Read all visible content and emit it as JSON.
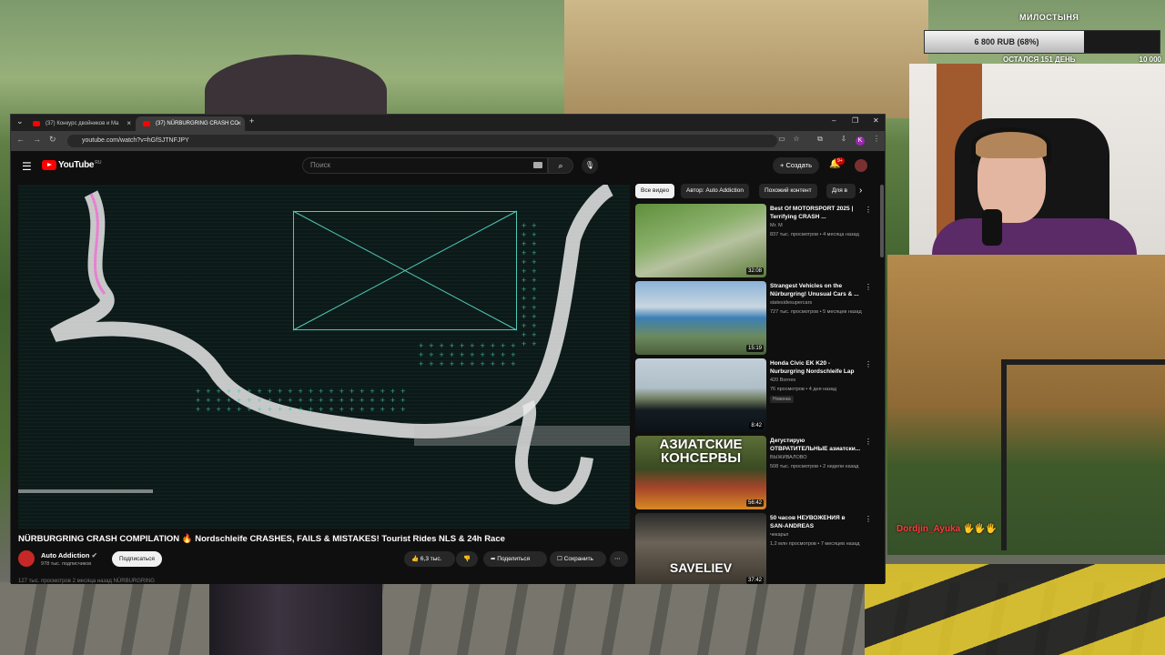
{
  "overlay": {
    "donation_title": "МИЛОСТЫНЯ",
    "donation_amount": "6 800 RUB (68%)",
    "donation_progress": 0.68,
    "donation_days_left": "ОСТАЛСЯ 151 ДЕНЬ",
    "donation_goal": "10 000",
    "chat_user": "Dordjin_Ayuka",
    "chat_message": "🖐🖐🖐"
  },
  "browser": {
    "tabs": [
      {
        "label": "(37) Конкурс двойников и Ма"
      },
      {
        "label": "(37) NÜRBURGRING CRASH CO"
      }
    ],
    "url": "youtube.com/watch?v=hGfSJTNFJPY",
    "new_tab": "+",
    "profile_letter": "K"
  },
  "youtube": {
    "logo_text": "YouTube",
    "region": "RU",
    "search_placeholder": "Поиск",
    "create_label": "Создать",
    "notification_count": "9+",
    "video": {
      "title": "NÜRBURGRING CRASH COMPILATION 🔥 Nordschleife CRASHES, FAILS & MISTAKES! Tourist Rides NLS & 24h Race",
      "channel": "Auto Addiction",
      "subscribers": "978 тыс. подписчиков",
      "subscribe_label": "Подписаться",
      "likes": "6,3 тыс.",
      "share_label": "Поделиться",
      "save_label": "Сохранить",
      "description": "127 тыс. просмотров  2 месяца назад  NÜRBURGRING"
    },
    "chips": [
      "Все видео",
      "Автор: Auto Addiction",
      "Похожий контент",
      "Для в"
    ],
    "recommendations": [
      {
        "title": "Best Of MOTORSPORT 2025 | Terrifying CRASH ...",
        "channel": "Mr. M",
        "meta": "837 тыс. просмотров • 4 месяца назад",
        "duration": "32:08",
        "badge": ""
      },
      {
        "title": "Strangest Vehicles on the Nürburgring! Unusual Cars & ...",
        "channel": "statesidesupercars",
        "meta": "727 тыс. просмотров • 5 месяцев назад",
        "duration": "15:19",
        "badge": ""
      },
      {
        "title": "Honda Civic EK K20 - Nurburgring Nordschleife Lap",
        "channel": "420 Bornes",
        "meta": "76 просмотров • 4 дня назад",
        "duration": "8:42",
        "badge": "Новинка"
      },
      {
        "title": "Дегустирую ОТВРАТИТЕЛЬНЫЕ азиатски...",
        "channel": "ВЫЖИВАЛОВО",
        "meta": "508 тыс. просмотров • 2 недели назад",
        "duration": "56:42",
        "badge": "",
        "thumb_text": "АЗИАТСКИЕ КОНСЕРВЫ"
      },
      {
        "title": "50 часов НЕУВОЖЕНИЯ в SAN-ANDREAS",
        "channel": "чекарьп",
        "meta": "1,2 млн просмотров • 7 месяцев назад",
        "duration": "37:42",
        "badge": "",
        "thumb_text": "SAVELIEV"
      }
    ]
  },
  "colors": {
    "accent": "#ff0000",
    "bg": "#0f0f0f",
    "chip_active": "#f1f1f1"
  }
}
